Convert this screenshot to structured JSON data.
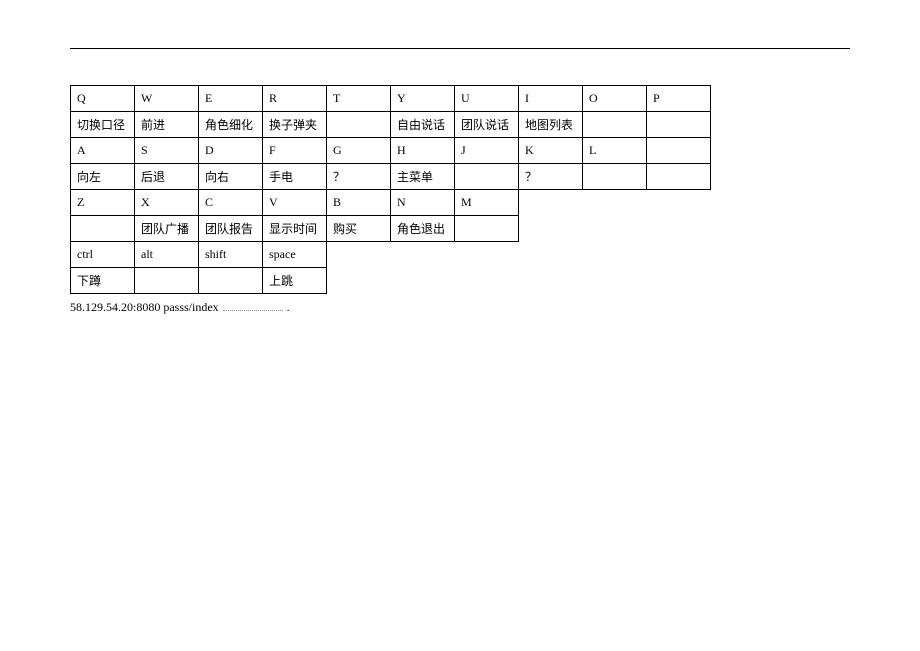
{
  "rows": {
    "r1": [
      "Q",
      "W",
      "E",
      "R",
      "T",
      "Y",
      "U",
      "I",
      "O",
      "P"
    ],
    "r2": [
      "切换口径",
      "前进",
      "角色细化",
      "换子弹夹",
      "",
      "自由说话",
      "团队说话",
      "地图列表",
      "",
      ""
    ],
    "r3": [
      "A",
      "S",
      "D",
      "F",
      "G",
      "H",
      "J",
      "K",
      "L",
      ""
    ],
    "r4": [
      "向左",
      "后退",
      "向右",
      "手电",
      "？",
      "主菜单",
      "",
      "？",
      "",
      ""
    ],
    "r5": [
      "Z",
      "X",
      "C",
      "V",
      "B",
      "N",
      "M"
    ],
    "r6": [
      "",
      "团队广播",
      "团队报告",
      "显示时间",
      "购买",
      "角色退出",
      ""
    ],
    "r7": [
      "ctrl",
      "alt",
      "shift",
      "space"
    ],
    "r8": [
      "下蹲",
      "",
      "",
      "上跳"
    ]
  },
  "footer_text": "58.129.54.20:8080 passs/index",
  "footer_trail": "."
}
